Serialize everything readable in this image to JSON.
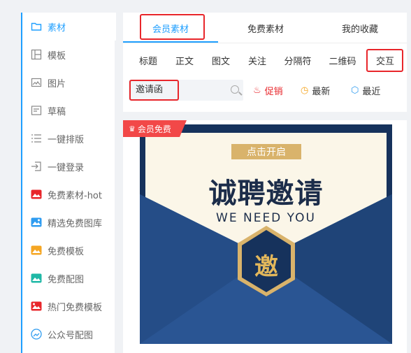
{
  "sidebar": {
    "items": [
      {
        "label": "素材",
        "icon": "folder-icon"
      },
      {
        "label": "模板",
        "icon": "template-icon"
      },
      {
        "label": "图片",
        "icon": "picture-icon"
      },
      {
        "label": "草稿",
        "icon": "draft-icon"
      },
      {
        "label": "一键排版",
        "icon": "list-icon"
      },
      {
        "label": "一键登录",
        "icon": "login-icon"
      },
      {
        "label": "免费素材-hot",
        "icon": "hot-image-icon"
      },
      {
        "label": "精选免费图库",
        "icon": "gallery-icon"
      },
      {
        "label": "免费模板",
        "icon": "free-template-icon"
      },
      {
        "label": "免费配图",
        "icon": "free-image-icon"
      },
      {
        "label": "热门免费模板",
        "icon": "hot-template-icon"
      },
      {
        "label": "公众号配图",
        "icon": "wechat-image-icon"
      }
    ]
  },
  "tabs": [
    "会员素材",
    "免费素材",
    "我的收藏"
  ],
  "categories": [
    "标题",
    "正文",
    "图文",
    "关注",
    "分隔符",
    "二维码",
    "交互"
  ],
  "search": {
    "value": "邀请函"
  },
  "filters": {
    "promo": "促销",
    "newest": "最新",
    "recent": "最近"
  },
  "card": {
    "badge": "会员免费",
    "poster": {
      "button": "点击开启",
      "title": "诚聘邀请",
      "subtitle": "WE NEED YOU",
      "emblem_char": "邀"
    }
  },
  "colors": {
    "accent": "#1f9fff",
    "highlight": "#e8262b",
    "badge": "#f24848",
    "navy": "#16325c",
    "gold": "#d9b36b"
  }
}
